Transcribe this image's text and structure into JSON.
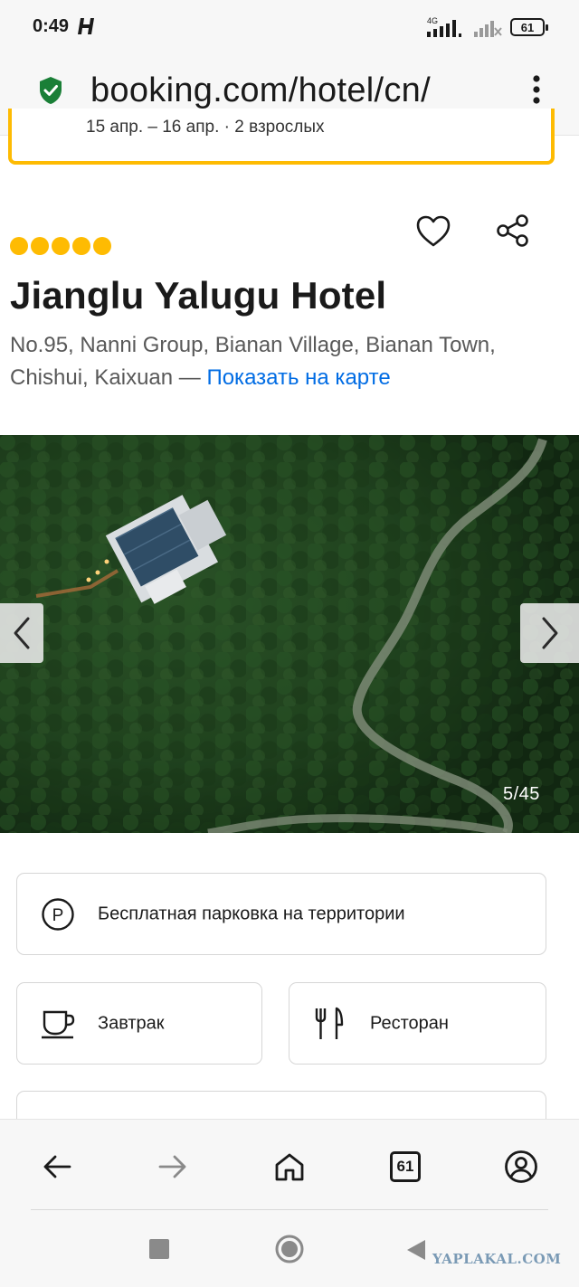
{
  "status_bar": {
    "time": "0:49",
    "network": "4G",
    "battery": "61"
  },
  "browser": {
    "url": "booking.com/hotel/cn/",
    "tab_count": "61"
  },
  "search_summary": {
    "text": "15 апр. – 16 апр. · 2 взрослых"
  },
  "hotel": {
    "star_count": 5,
    "name": "Jianglu Yalugu Hotel",
    "address": "No.95, Nanni Group, Bianan Village, Bianan Town, Chishui, Kaixuan —",
    "map_link": "Показать на карте"
  },
  "gallery": {
    "counter": "5/45"
  },
  "facilities": [
    {
      "label": "Бесплатная парковка на территории",
      "icon": "parking-icon"
    },
    {
      "label": "Завтрак",
      "icon": "coffee-cup-icon"
    },
    {
      "label": "Ресторан",
      "icon": "fork-knife-icon"
    }
  ],
  "watermark": "YAPLAKAL.COM",
  "colors": {
    "accent_yellow": "#febb02",
    "link_blue": "#006ce4",
    "secure_green": "#1a7f37"
  }
}
